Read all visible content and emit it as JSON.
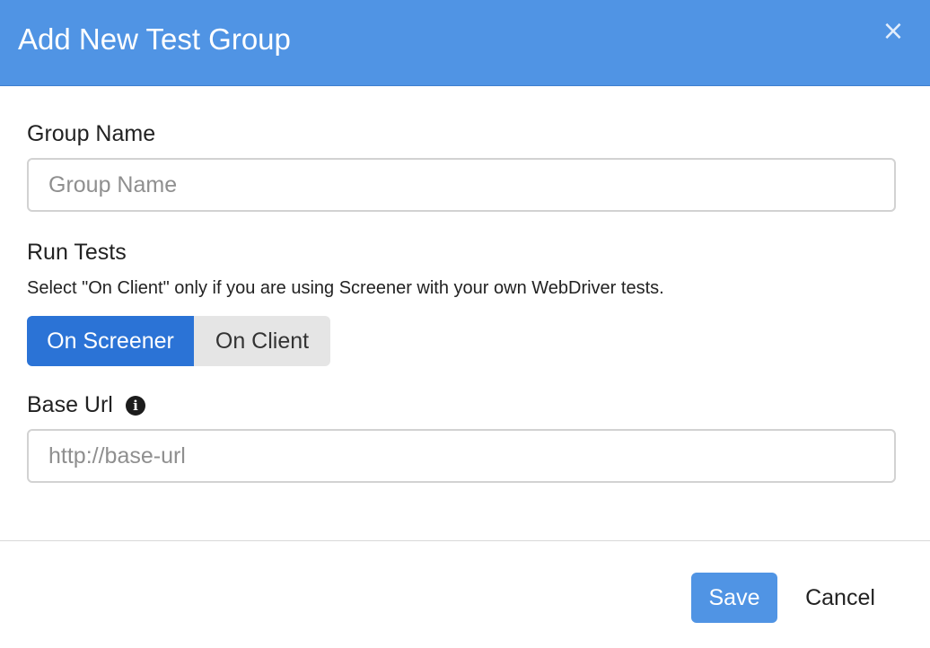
{
  "modal": {
    "title": "Add New Test Group",
    "close_glyph": "×",
    "close_icon": "close-icon"
  },
  "form": {
    "group_name": {
      "label": "Group Name",
      "placeholder": "Group Name",
      "value": ""
    },
    "run_tests": {
      "label": "Run Tests",
      "helper": "Select \"On Client\" only if you are using Screener with your own WebDriver tests.",
      "options": [
        "On Screener",
        "On Client"
      ],
      "selected": "On Screener"
    },
    "base_url": {
      "label": "Base Url",
      "info_icon": "info-icon",
      "info_glyph": "i",
      "placeholder": "http://base-url",
      "value": ""
    }
  },
  "footer": {
    "save_label": "Save",
    "cancel_label": "Cancel"
  },
  "colors": {
    "header": "#5094e4",
    "active_toggle": "#2b73d6",
    "inactive_toggle": "#e5e5e5",
    "primary_button": "#5094e4"
  }
}
